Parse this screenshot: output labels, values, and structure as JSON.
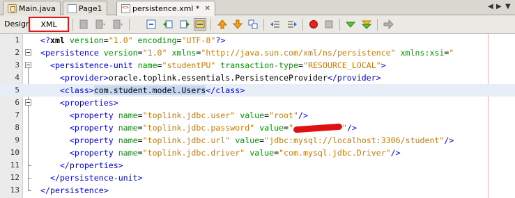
{
  "tabs": [
    {
      "label": "Main.java",
      "icon": "java-file-icon",
      "closable": false
    },
    {
      "label": "Page1",
      "icon": "page-icon",
      "closable": false
    },
    {
      "label": "persistence.xml *",
      "icon": "xml-file-icon",
      "closable": true,
      "active": true
    }
  ],
  "view_switch": {
    "design_label": "Design",
    "xml_label": "XML",
    "active": "XML"
  },
  "toolbar_icons": [
    "toggle-bookmark-icon",
    "previous-bookmark-icon",
    "next-bookmark-icon",
    "find-selection-icon",
    "find-previous-icon",
    "find-next-icon",
    "toggle-highlight-search-icon",
    "previous-occurrence-icon",
    "next-occurrence-icon",
    "toggle-rectangular-selection-icon",
    "shift-left-icon",
    "shift-right-icon",
    "start-macro-recording-icon",
    "stop-macro-recording-icon",
    "check-xml-icon",
    "validate-xml-icon",
    "run-xsl-icon"
  ],
  "editor": {
    "lines": [
      {
        "num": "1",
        "text": "<?xml version=\"1.0\" encoding=\"UTF-8\"?>"
      },
      {
        "num": "2",
        "text": "<persistence version=\"1.0\" xmlns=\"http://java.sun.com/xml/ns/persistence\" xmlns:xsi=\""
      },
      {
        "num": "3",
        "text": "  <persistence-unit name=\"studentPU\" transaction-type=\"RESOURCE_LOCAL\">"
      },
      {
        "num": "4",
        "text": "    <provider>oracle.toplink.essentials.PersistenceProvider</provider>"
      },
      {
        "num": "5",
        "text": "    <class>com.student.model.Users</class>"
      },
      {
        "num": "6",
        "text": "    <properties>"
      },
      {
        "num": "7",
        "text": "      <property name=\"toplink.jdbc.user\" value=\"root\"/>"
      },
      {
        "num": "8",
        "text": "      <property name=\"toplink.jdbc.password\" value=\"\"/>"
      },
      {
        "num": "9",
        "text": "      <property name=\"toplink.jdbc.url\" value=\"jdbc:mysql://localhost:3306/student\"/>"
      },
      {
        "num": "10",
        "text": "      <property name=\"toplink.jdbc.driver\" value=\"com.mysql.jdbc.Driver\"/>"
      },
      {
        "num": "11",
        "text": "    </properties>"
      },
      {
        "num": "12",
        "text": "  </persistence-unit>"
      },
      {
        "num": "13",
        "text": "</persistence>"
      }
    ],
    "highlighted_line": 5,
    "selected_text": "com.student.model.Users"
  },
  "colors": {
    "tag": "#0000e6",
    "attr": "#009900",
    "value": "#ce7b00",
    "redaction": "#e01010",
    "current_line": "#e8eef7"
  }
}
